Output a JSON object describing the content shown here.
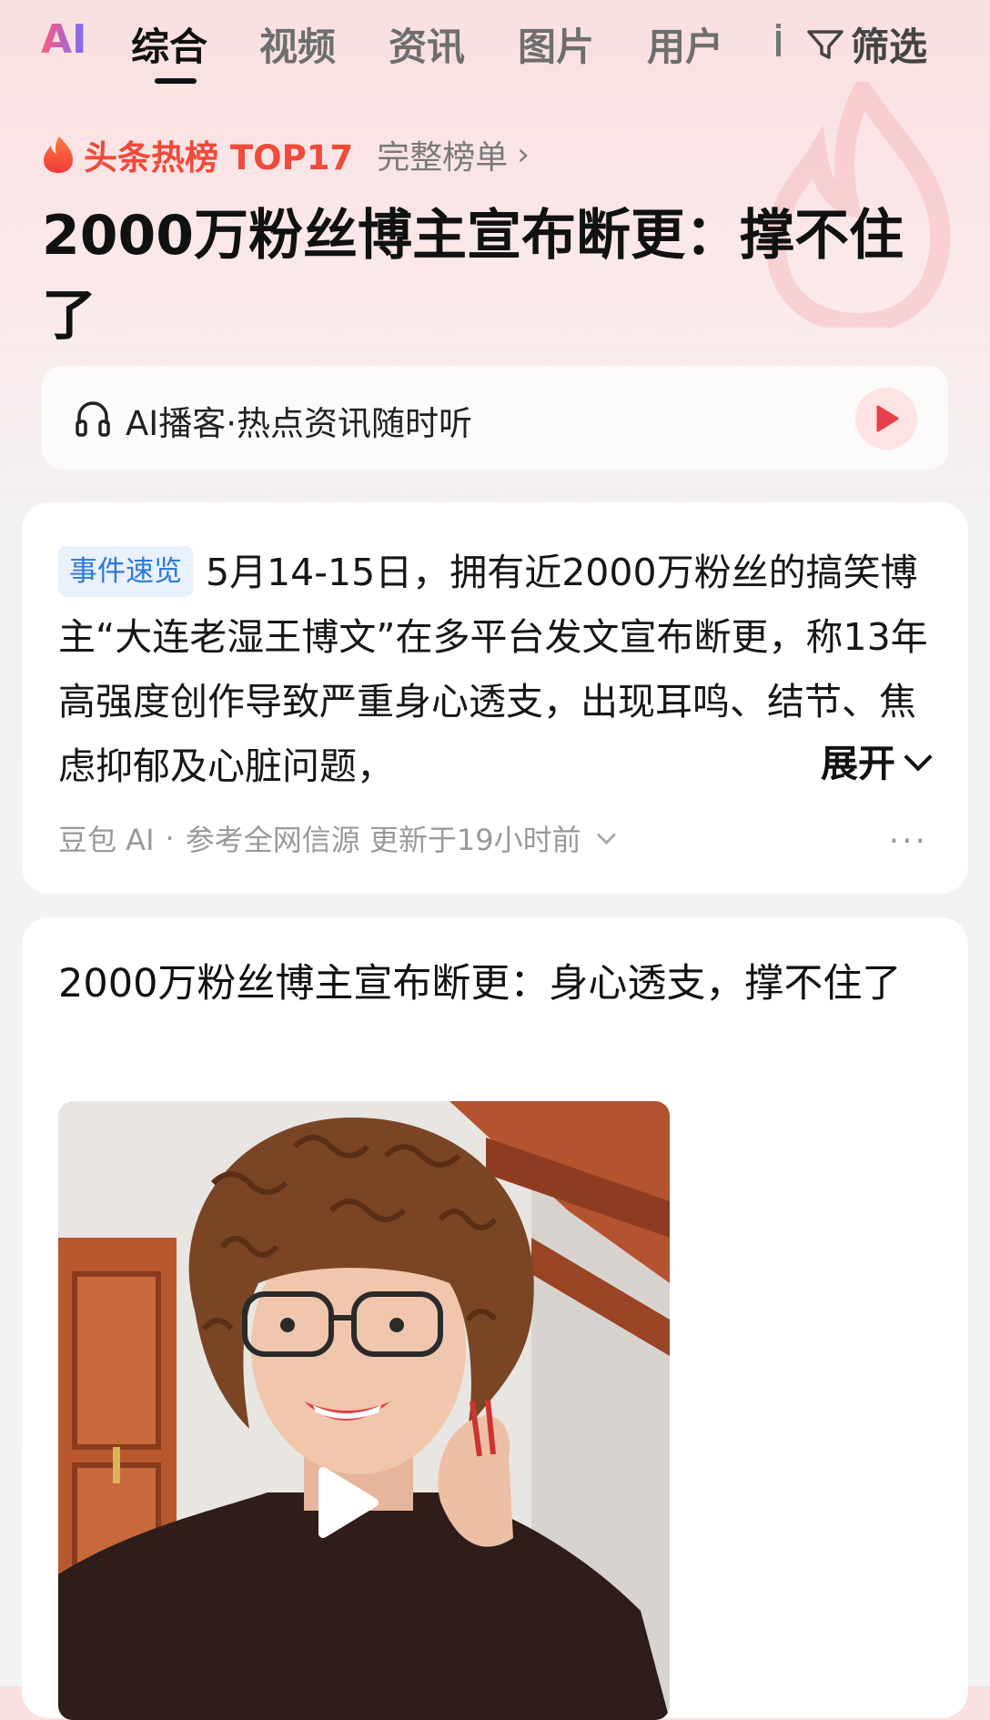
{
  "tabs": {
    "logo": "AI",
    "items": [
      "综合",
      "视频",
      "资讯",
      "图片",
      "用户"
    ],
    "active_index": 0,
    "filter_label": "筛选"
  },
  "hot": {
    "label": "头条热榜 TOP17",
    "full_list": "完整榜单",
    "headline": "2000万粉丝博主宣布断更：撑不住了",
    "accent_color": "#f04a3a"
  },
  "podcast": {
    "text": "AI播客·热点资讯随时听",
    "play_color": "#e8404a"
  },
  "summary": {
    "tag": "事件速览",
    "text": "5月14-15日，拥有近2000万粉丝的搞笑博主“大连老湿王博文”在多平台发文宣布断更，称13年高强度创作导致严重身心透支，出现耳鸣、结节、焦虑抑郁及心脏问题，",
    "expand_label": "展开",
    "source_ai": "豆包 AI",
    "source_separator": "·",
    "source_text": "参考全网信源 更新于19小时前",
    "more": "···"
  },
  "video_card": {
    "title": "2000万粉丝博主宣布断更：身心透支，撑不住了"
  }
}
